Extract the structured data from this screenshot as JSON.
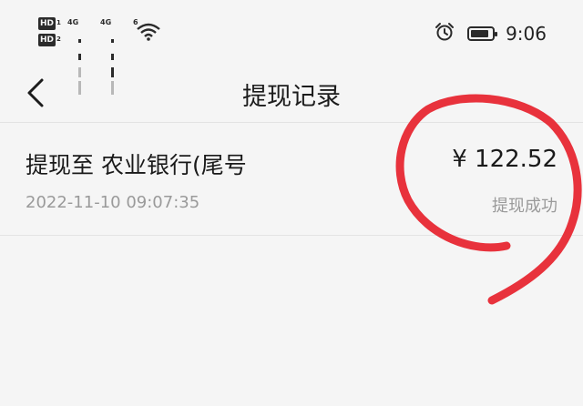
{
  "status_bar": {
    "sim1_badge": "HD",
    "sim1_index": "1",
    "sim2_badge": "HD",
    "sim2_index": "2",
    "signal1_tag": "4G",
    "signal2_tag": "4G",
    "wifi_tag": "6",
    "time": "9:06",
    "icons": [
      "alarm-icon",
      "battery-icon",
      "wifi-icon",
      "signal-icon"
    ]
  },
  "header": {
    "title": "提现记录",
    "back_icon": "chevron-left-icon"
  },
  "records": [
    {
      "title": "提现至 农业银行(尾号",
      "amount": "¥ 122.52",
      "time": "2022-11-10 09:07:35",
      "status": "提现成功"
    }
  ],
  "colors": {
    "annotation_red": "#e8323c",
    "background": "#f5f5f5",
    "secondary_text": "#9a9a9a"
  }
}
